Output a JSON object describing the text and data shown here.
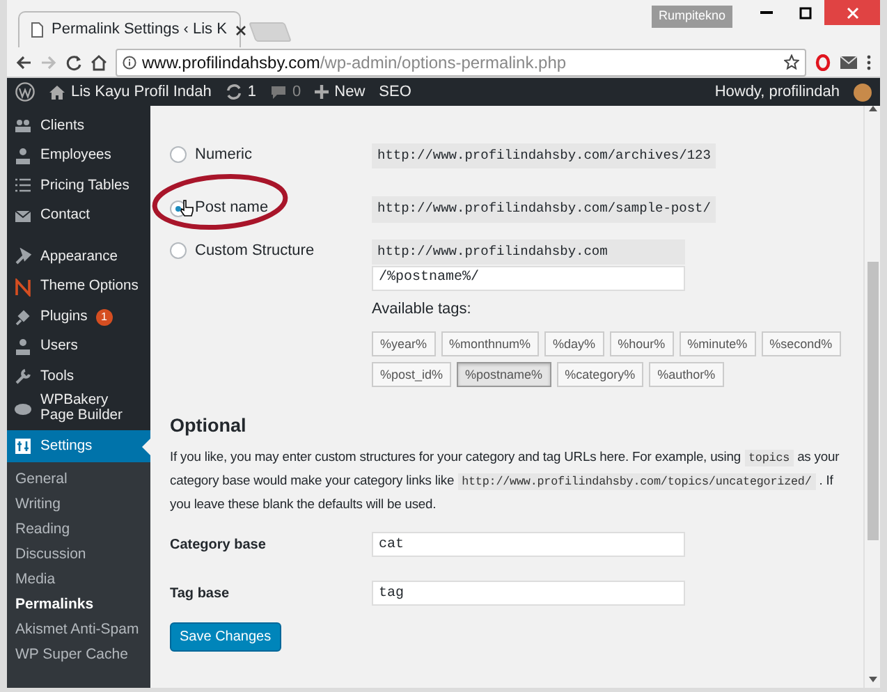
{
  "browser": {
    "tab_title": "Permalink Settings ‹ Lis K",
    "profile": "Rumpitekno",
    "url_domain": "www.profilindahsby.com",
    "url_path": "/wp-admin/options-permalink.php"
  },
  "admin_bar": {
    "site": "Lis Kayu Profil Indah",
    "updates": "1",
    "comments": "0",
    "new": "New",
    "seo": "SEO",
    "greeting": "Howdy, profilindah"
  },
  "sidebar": {
    "items": [
      {
        "label": "Clients",
        "selected": false
      },
      {
        "label": "Employees",
        "selected": false
      },
      {
        "label": "Pricing Tables",
        "selected": false
      },
      {
        "label": "Contact",
        "selected": false
      },
      {
        "label": "Appearance",
        "selected": false
      },
      {
        "label": "Theme Options",
        "selected": false
      },
      {
        "label": "Plugins",
        "badge": "1",
        "selected": false
      },
      {
        "label": "Users",
        "selected": false
      },
      {
        "label": "Tools",
        "selected": false
      },
      {
        "label": "WPBakery Page Builder",
        "selected": false
      },
      {
        "label": "Settings",
        "selected": true
      }
    ],
    "submenu": [
      {
        "label": "General",
        "selected": false
      },
      {
        "label": "Writing",
        "selected": false
      },
      {
        "label": "Reading",
        "selected": false
      },
      {
        "label": "Discussion",
        "selected": false
      },
      {
        "label": "Media",
        "selected": false
      },
      {
        "label": "Permalinks",
        "selected": true
      },
      {
        "label": "Akismet Anti-Spam",
        "selected": false
      },
      {
        "label": "WP Super Cache",
        "selected": false
      }
    ]
  },
  "permalink_options": [
    {
      "label": "Numeric",
      "selected": false,
      "example": "http://www.profilindahsby.com/archives/123"
    },
    {
      "label": "Post name",
      "selected": true,
      "example": "http://www.profilindahsby.com/sample-post/"
    },
    {
      "label": "Custom Structure",
      "selected": false,
      "example": "http://www.profilindahsby.com",
      "value": "/%postname%/"
    }
  ],
  "available_tags_label": "Available tags:",
  "tags": [
    {
      "label": "%year%",
      "selected": false
    },
    {
      "label": "%monthnum%",
      "selected": false
    },
    {
      "label": "%day%",
      "selected": false
    },
    {
      "label": "%hour%",
      "selected": false
    },
    {
      "label": "%minute%",
      "selected": false
    },
    {
      "label": "%second%",
      "selected": false
    },
    {
      "label": "%post_id%",
      "selected": false
    },
    {
      "label": "%postname%",
      "selected": true
    },
    {
      "label": "%category%",
      "selected": false
    },
    {
      "label": "%author%",
      "selected": false
    }
  ],
  "optional": {
    "heading": "Optional",
    "paragraph": [
      {
        "kind": "text",
        "text": "If you like, you may enter custom structures for your category and tag URLs here. For example, using "
      },
      {
        "kind": "code",
        "text": "topics"
      },
      {
        "kind": "text",
        "text": " as your category base would make your category links like "
      },
      {
        "kind": "code",
        "text": "http://www.profilindahsby.com/topics/uncategorized/"
      },
      {
        "kind": "text",
        "text": " . If you leave these blank the defaults will be used."
      }
    ]
  },
  "fields": [
    {
      "label": "Category base",
      "value": "cat"
    },
    {
      "label": "Tag base",
      "value": "tag"
    }
  ],
  "save_button": "Save Changes"
}
